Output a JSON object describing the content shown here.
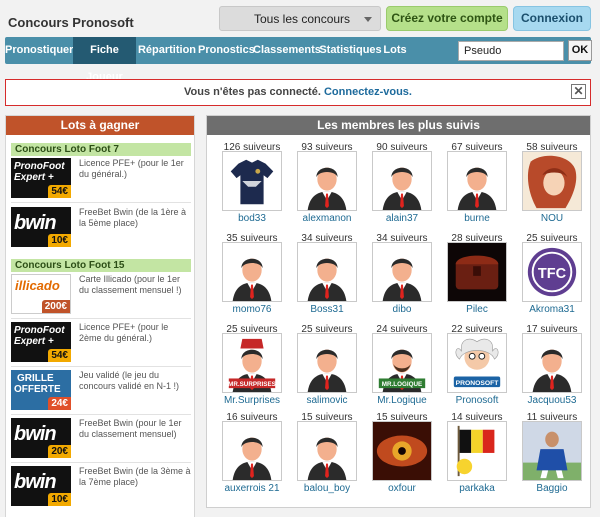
{
  "header": {
    "site_title": "Concours Pronosoft",
    "contest_select": "Tous les concours",
    "create_account": "Créez votre compte",
    "login": "Connexion"
  },
  "nav": {
    "items": [
      "Pronostiquer",
      "Fiche Joueur",
      "Répartition",
      "Pronostics",
      "Classements",
      "Statistiques",
      "Lots"
    ],
    "active": "Fiche Joueur",
    "search_value": "Pseudo",
    "ok": "OK"
  },
  "alert": {
    "text": "Vous n'êtes pas connecté.",
    "link": "Connectez-vous.",
    "close": "✕"
  },
  "lots": {
    "title": "Lots à gagner",
    "groups": [
      {
        "name": "Concours Loto Foot 7",
        "prizes": [
          {
            "logo_line1": "PronoFoot",
            "logo_line2": "Expert +",
            "price": "54€",
            "desc": "Licence PFE+ (pour le 1er du général.)"
          },
          {
            "logo_line1": "bwin",
            "logo_line2": "",
            "price": "10€",
            "desc": "FreeBet Bwin (de la 1ère à la 5ème place)"
          }
        ]
      },
      {
        "name": "Concours Loto Foot 15",
        "prizes": [
          {
            "logo_line1": "illicado",
            "logo_line2": "",
            "price": "200€",
            "desc": "Carte Illicado (pour le 1er du classement mensuel !)"
          },
          {
            "logo_line1": "PronoFoot",
            "logo_line2": "Expert +",
            "price": "54€",
            "desc": "Licence PFE+ (pour le 2ème du général.)"
          },
          {
            "logo_line1": "GRILLE",
            "logo_line2": "OFFERTE",
            "price": "24€",
            "desc": "Jeu validé (le jeu du concours validé en N-1 !)"
          },
          {
            "logo_line1": "bwin",
            "logo_line2": "",
            "price": "20€",
            "desc": "FreeBet Bwin (pour le 1er du classement mensuel)"
          },
          {
            "logo_line1": "bwin",
            "logo_line2": "",
            "price": "10€",
            "desc": "FreeBet Bwin (de la 3ème à la 7ème place)"
          }
        ]
      }
    ]
  },
  "members": {
    "title": "Les membres les plus suivis",
    "list": [
      {
        "followers": "126 suiveurs",
        "name": "bod33",
        "avatar": "jersey"
      },
      {
        "followers": "93 suiveurs",
        "name": "alexmanon",
        "avatar": "default"
      },
      {
        "followers": "90 suiveurs",
        "name": "alain37",
        "avatar": "default"
      },
      {
        "followers": "67 suiveurs",
        "name": "burne",
        "avatar": "default"
      },
      {
        "followers": "58 suiveurs",
        "name": "NOU",
        "avatar": "anime"
      },
      {
        "followers": "35 suiveurs",
        "name": "momo76",
        "avatar": "default"
      },
      {
        "followers": "34 suiveurs",
        "name": "Boss31",
        "avatar": "default"
      },
      {
        "followers": "34 suiveurs",
        "name": "dibo",
        "avatar": "default"
      },
      {
        "followers": "28 suiveurs",
        "name": "Pilec",
        "avatar": "chest"
      },
      {
        "followers": "25 suiveurs",
        "name": "Akroma31",
        "avatar": "tfc"
      },
      {
        "followers": "25 suiveurs",
        "name": "Mr.Surprises",
        "avatar": "surprises"
      },
      {
        "followers": "25 suiveurs",
        "name": "salimovic",
        "avatar": "default"
      },
      {
        "followers": "24 suiveurs",
        "name": "Mr.Logique",
        "avatar": "logique"
      },
      {
        "followers": "22 suiveurs",
        "name": "Pronosoft",
        "avatar": "pronosoft"
      },
      {
        "followers": "17 suiveurs",
        "name": "Jacquou53",
        "avatar": "default"
      },
      {
        "followers": "16 suiveurs",
        "name": "auxerrois 21",
        "avatar": "default"
      },
      {
        "followers": "15 suiveurs",
        "name": "balou_boy",
        "avatar": "default"
      },
      {
        "followers": "15 suiveurs",
        "name": "oxfour",
        "avatar": "eye"
      },
      {
        "followers": "14 suiveurs",
        "name": "parkaka",
        "avatar": "flag"
      },
      {
        "followers": "11 suiveurs",
        "name": "Baggio",
        "avatar": "player"
      }
    ],
    "avatar_labels": {
      "surprises": "MR.SURPRISES",
      "logique": "MR.LOGIQUE",
      "pronosoft": "PRONOSOFT",
      "tfc": "TFC"
    }
  },
  "colors": {
    "nav": "#4a8fa9",
    "nav_active": "#245a72",
    "lots_header": "#c0532a",
    "contest_bar": "#c3e5a3",
    "members_header": "#6e6e6e",
    "alert_border": "#d62b2b",
    "link": "#1e6a92"
  }
}
